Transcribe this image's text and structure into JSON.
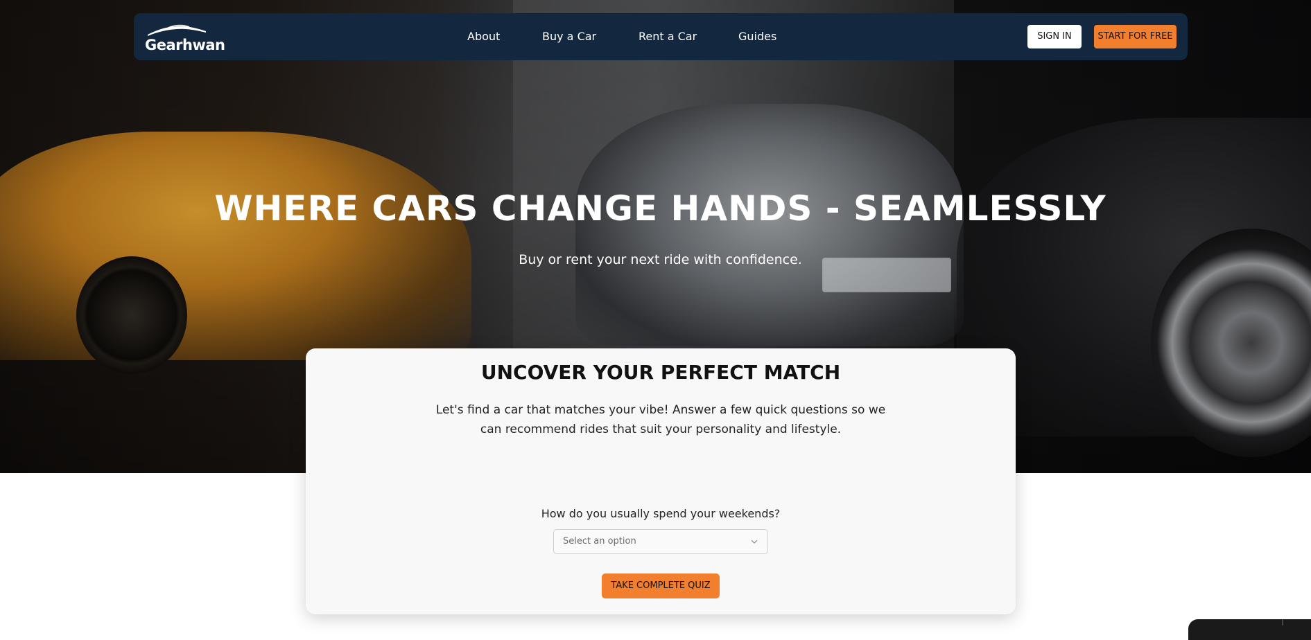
{
  "nav": {
    "logo_text": "Gearhwan",
    "links": [
      "About",
      "Buy a Car",
      "Rent a Car",
      "Guides"
    ],
    "sign_in": "SIGN IN",
    "start": "START FOR FREE"
  },
  "hero": {
    "title": "WHERE CARS CHANGE HANDS - SEAMLESSLY",
    "subtitle": "Buy or rent your next ride with confidence."
  },
  "quiz": {
    "title": "UNCOVER YOUR PERFECT MATCH",
    "description": "Let's find a car that matches your vibe! Answer a few quick questions so we can recommend rides that suit your personality and lifestyle.",
    "question": "How do you usually spend your weekends?",
    "select_placeholder": "Select an option",
    "button": "TAKE COMPLETE QUIZ"
  },
  "colors": {
    "navbar": "#13273f",
    "accent": "#f17f2e"
  }
}
